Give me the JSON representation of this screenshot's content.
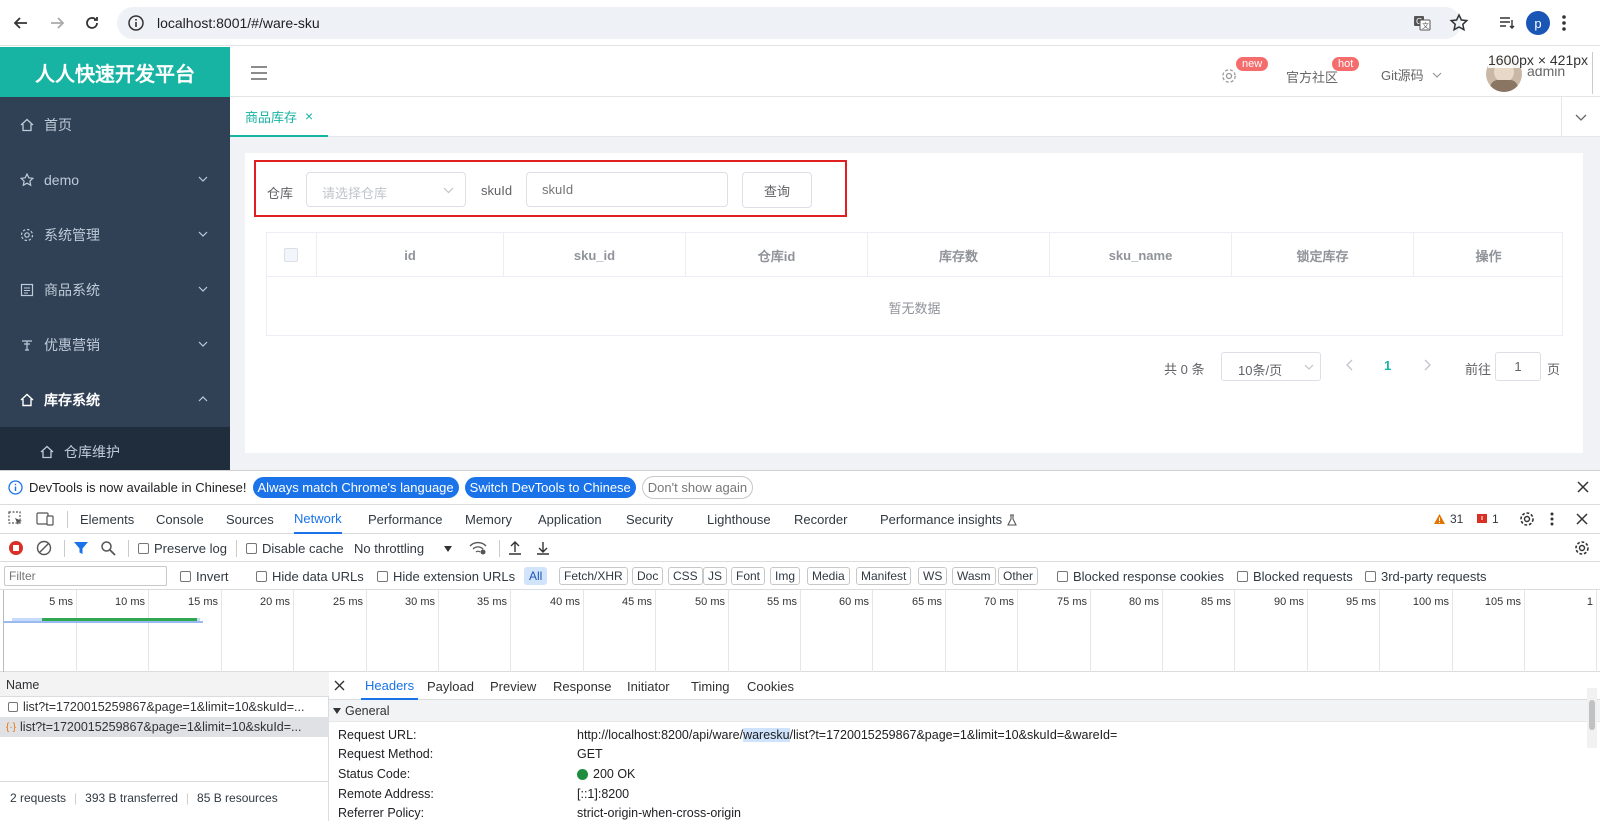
{
  "browser": {
    "url": "localhost:8001/#/ware-sku",
    "profile_initial": "p",
    "viewport_overlay": "1600px × 421px"
  },
  "app": {
    "logo": "人人快速开发平台",
    "menu": [
      {
        "label": "首页",
        "icon": "home-icon",
        "expandable": false
      },
      {
        "label": "demo",
        "icon": "star-icon",
        "expandable": true
      },
      {
        "label": "系统管理",
        "icon": "gear-icon",
        "expandable": true
      },
      {
        "label": "商品系统",
        "icon": "document-icon",
        "expandable": true
      },
      {
        "label": "优惠营销",
        "icon": "tag-icon",
        "expandable": true
      },
      {
        "label": "库存系统",
        "icon": "home-icon",
        "expandable": true,
        "expanded": true
      }
    ],
    "submenu": [
      {
        "label": "仓库维护",
        "icon": "home-icon"
      }
    ],
    "header": {
      "badge_new": "new",
      "community": "官方社区",
      "badge_hot": "hot",
      "git": "Git源码",
      "user": "admin"
    },
    "tab": {
      "label": "商品库存",
      "close": "×"
    },
    "search": {
      "warehouse_label": "仓库",
      "warehouse_placeholder": "请选择仓库",
      "skuid_label": "skuId",
      "skuid_placeholder": "skuId",
      "query_button": "查询"
    },
    "table": {
      "columns": [
        "id",
        "sku_id",
        "仓库id",
        "库存数",
        "sku_name",
        "锁定库存",
        "操作"
      ],
      "empty_text": "暂无数据"
    },
    "pagination": {
      "total": "共 0 条",
      "page_size": "10条/页",
      "current_page": "1",
      "goto_label": "前往",
      "goto_value": "1",
      "page_suffix": "页"
    }
  },
  "devtools": {
    "notice": {
      "text": "DevTools is now available in Chinese!",
      "btn_match": "Always match Chrome's language",
      "btn_switch": "Switch DevTools to Chinese",
      "btn_dismiss": "Don't show again"
    },
    "tabs": [
      "Elements",
      "Console",
      "Sources",
      "Network",
      "Performance",
      "Memory",
      "Application",
      "Security",
      "Lighthouse",
      "Recorder",
      "Performance insights"
    ],
    "active_tab": "Network",
    "warnings_count": "31",
    "issues_count": "1",
    "toolbar": {
      "preserve_log": "Preserve log",
      "disable_cache": "Disable cache",
      "throttling": "No throttling"
    },
    "filter": {
      "placeholder": "Filter",
      "invert": "Invert",
      "hide_data_urls": "Hide data URLs",
      "hide_extension_urls": "Hide extension URLs",
      "types": [
        "All",
        "Fetch/XHR",
        "Doc",
        "CSS",
        "JS",
        "Font",
        "Img",
        "Media",
        "Manifest",
        "WS",
        "Wasm",
        "Other"
      ],
      "blocked_response_cookies": "Blocked response cookies",
      "blocked_requests": "Blocked requests",
      "third_party": "3rd-party requests"
    },
    "timeline_ticks": [
      "5 ms",
      "10 ms",
      "15 ms",
      "20 ms",
      "25 ms",
      "30 ms",
      "35 ms",
      "40 ms",
      "45 ms",
      "50 ms",
      "55 ms",
      "60 ms",
      "65 ms",
      "70 ms",
      "75 ms",
      "80 ms",
      "85 ms",
      "90 ms",
      "95 ms",
      "100 ms",
      "105 ms",
      "1"
    ],
    "requests": {
      "header": "Name",
      "items": [
        "list?t=1720015259867&page=1&limit=10&skuId=...",
        "list?t=1720015259867&page=1&limit=10&skuId=..."
      ],
      "summary": {
        "count": "2 requests",
        "transferred": "393 B transferred",
        "resources": "85 B resources"
      }
    },
    "details": {
      "tabs": [
        "Headers",
        "Payload",
        "Preview",
        "Response",
        "Initiator",
        "Timing",
        "Cookies"
      ],
      "active_tab": "Headers",
      "section": "General",
      "rows": [
        {
          "key": "Request URL:",
          "pre": "http://localhost:8200/api/ware/",
          "highlight": "waresku",
          "post": "/list?t=1720015259867&page=1&limit=10&skuId=&wareId="
        },
        {
          "key": "Request Method:",
          "value": "GET"
        },
        {
          "key": "Status Code:",
          "value": "200 OK"
        },
        {
          "key": "Remote Address:",
          "value": "[::1]:8200"
        },
        {
          "key": "Referrer Policy:",
          "value": "strict-origin-when-cross-origin"
        }
      ]
    }
  },
  "colors": {
    "brand": "#17b3a3",
    "sidebar": "#304156",
    "highlight_box": "#e02020",
    "devtools_blue": "#1a73e8",
    "status_green": "#1e8e3e"
  }
}
